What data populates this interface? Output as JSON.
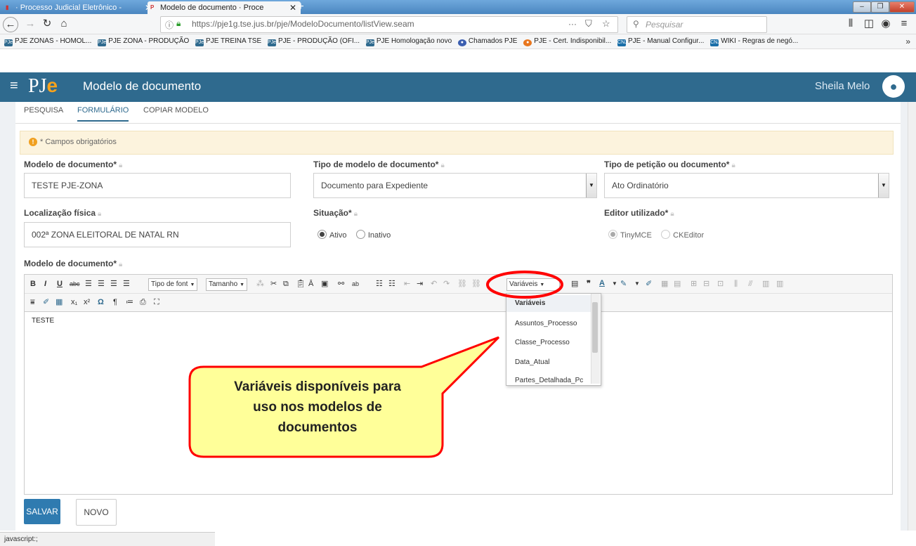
{
  "browser": {
    "tabs": [
      {
        "title": "· Processo Judicial Eletrônico - ",
        "close": "✕"
      },
      {
        "title": "Modelo de documento · Proce",
        "close": "✕"
      }
    ],
    "url": "https://pje1g.tse.jus.br/pje/ModeloDocumento/listView.seam",
    "search_placeholder": "Pesquisar",
    "bookmarks": [
      "PJE ZONAS - HOMOL...",
      "PJE ZONA - PRODUÇÃO",
      "PJE TREINA TSE",
      "PJE - PRODUÇÃO (OFI...",
      "PJE Homologação novo",
      "Chamados PJE",
      "PJE - Cert. Indisponibil...",
      "PJE - Manual Configur...",
      "WIKI - Regras de negó..."
    ],
    "status": "javascript:;"
  },
  "app": {
    "logo_p": "PJ",
    "logo_e": "e",
    "title": "Modelo de documento",
    "user": "Sheila Melo"
  },
  "subtabs": [
    "PESQUISA",
    "FORMULÁRIO",
    "COPIAR MODELO"
  ],
  "alert": "* Campos obrigatórios",
  "form": {
    "modelo_label": "Modelo de documento*",
    "modelo_value": "TESTE PJE-ZONA",
    "tipo_modelo_label": "Tipo de modelo de documento*",
    "tipo_modelo_value": "Documento para Expediente",
    "tipo_peticao_label": "Tipo de petição ou documento*",
    "tipo_peticao_value": "Ato Ordinatório",
    "localizacao_label": "Localização física",
    "localizacao_value": "002ª ZONA ELEITORAL DE NATAL RN",
    "situacao_label": "Situação*",
    "situacao_ativo": "Ativo",
    "situacao_inativo": "Inativo",
    "editor_label": "Editor utilizado*",
    "editor_tiny": "TinyMCE",
    "editor_ck": "CKEditor",
    "conteudo_label": "Modelo de documento*"
  },
  "editor": {
    "font_select": "Tipo de font",
    "size_select": "Tamanho",
    "variables_select": "Variáveis",
    "content": "TESTE"
  },
  "variables_dropdown": [
    "Variáveis",
    "Assuntos_Processo",
    "Classe_Processo",
    "Data_Atual",
    "Partes_Detalhada_Pc"
  ],
  "callout": [
    "Variáveis disponíveis para",
    "uso nos  modelos de",
    "documentos"
  ],
  "buttons": {
    "save": "SALVAR",
    "new": "NOVO"
  },
  "colors": {
    "header": "#2f6a8e",
    "highlight": "#ff0000",
    "callout_fill": "#ffff99"
  }
}
